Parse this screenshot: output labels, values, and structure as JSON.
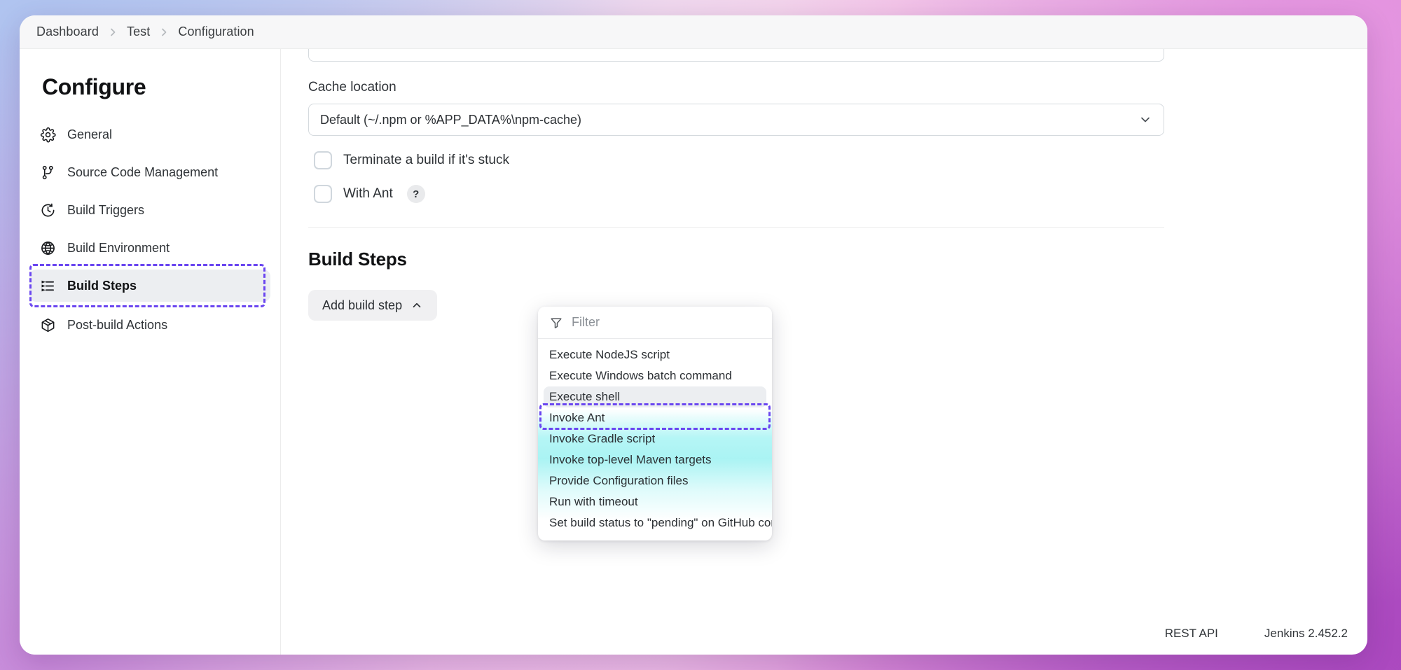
{
  "breadcrumb": {
    "items": [
      {
        "label": "Dashboard"
      },
      {
        "label": "Test"
      },
      {
        "label": "Configuration"
      }
    ]
  },
  "sidebar": {
    "title": "Configure",
    "items": [
      {
        "label": "General",
        "icon": "gear-icon"
      },
      {
        "label": "Source Code Management",
        "icon": "branch-icon"
      },
      {
        "label": "Build Triggers",
        "icon": "clock-icon"
      },
      {
        "label": "Build Environment",
        "icon": "globe-icon"
      },
      {
        "label": "Build Steps",
        "icon": "list-icon",
        "active": true,
        "highlighted": true
      },
      {
        "label": "Post-build Actions",
        "icon": "package-icon"
      }
    ]
  },
  "main": {
    "cache": {
      "label": "Cache location",
      "value": "Default (~/.npm or %APP_DATA%\\npm-cache)",
      "chevron": "chevron-down-icon"
    },
    "checkboxes": [
      {
        "label": "Terminate a build if it's stuck",
        "checked": false,
        "help": null
      },
      {
        "label": "With Ant",
        "checked": false,
        "help": "?"
      }
    ],
    "build_steps": {
      "title": "Build Steps",
      "add_button": {
        "label": "Add build step",
        "chevron": "chevron-up-icon"
      }
    }
  },
  "dropdown": {
    "filter": {
      "placeholder": "Filter",
      "value": "",
      "icon": "filter-icon"
    },
    "items": [
      {
        "label": "Execute NodeJS script"
      },
      {
        "label": "Execute Windows batch command"
      },
      {
        "label": "Execute shell",
        "selected": true,
        "highlighted": true
      },
      {
        "label": "Invoke Ant"
      },
      {
        "label": "Invoke Gradle script"
      },
      {
        "label": "Invoke top-level Maven targets"
      },
      {
        "label": "Provide Configuration files"
      },
      {
        "label": "Run with timeout"
      },
      {
        "label": "Set build status to \"pending\" on GitHub commit"
      }
    ]
  },
  "footer": {
    "rest_api": "REST API",
    "version": "Jenkins 2.452.2"
  },
  "colors": {
    "highlight_outline": "#6a46f0",
    "selected_bg": "#eceef1",
    "wash": "#76ecec"
  }
}
